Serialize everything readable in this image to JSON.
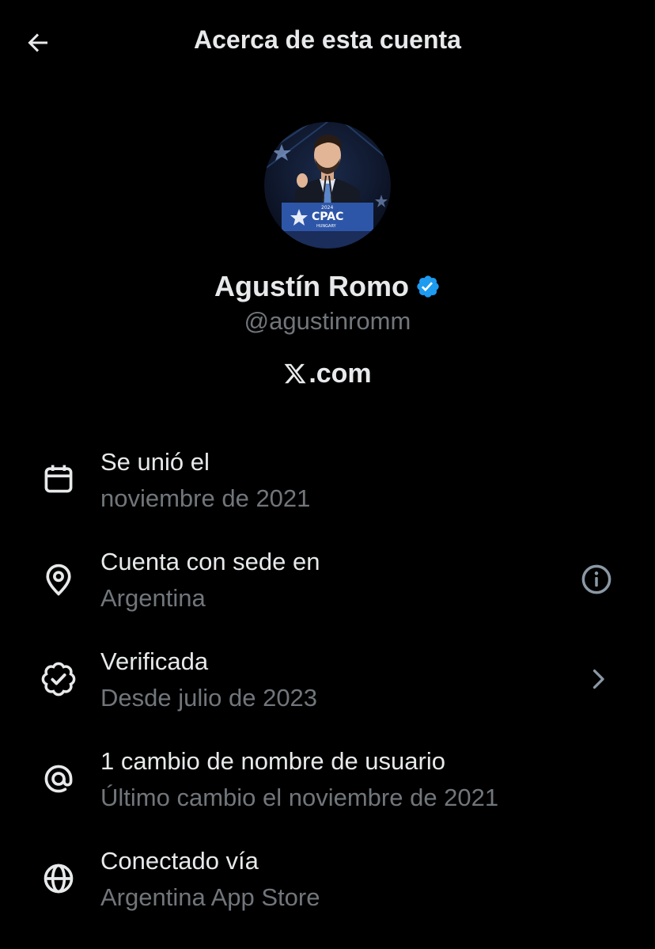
{
  "header": {
    "title": "Acerca de esta cuenta",
    "back_icon": "arrow-left-icon"
  },
  "profile": {
    "name": "Agustín Romo",
    "handle": "@agustinromm",
    "site_logo": "x-logo-icon",
    "site_suffix": ".com",
    "verified_color": "#1d9bf0",
    "avatar_sign_text": "CPAC",
    "avatar_sign_year": "2024",
    "avatar_sign_place": "HUNGARY"
  },
  "rows": [
    {
      "icon": "calendar-icon",
      "title": "Se unió el",
      "subtitle": "noviembre de 2021"
    },
    {
      "icon": "location-pin-icon",
      "title": "Cuenta con sede en",
      "subtitle": "Argentina",
      "action_icon": "info-icon"
    },
    {
      "icon": "verified-badge-outline-icon",
      "title": "Verificada",
      "subtitle": "Desde julio de 2023",
      "action_icon": "chevron-right-icon"
    },
    {
      "icon": "at-sign-icon",
      "title": "1 cambio de nombre de usuario",
      "subtitle": "Último cambio el noviembre de 2021"
    },
    {
      "icon": "globe-icon",
      "title": "Conectado vía",
      "subtitle": "Argentina App Store"
    }
  ],
  "colors": {
    "background": "#000000",
    "primary_text": "#e7e9ea",
    "secondary_text": "#71767b",
    "verified": "#1d9bf0"
  }
}
